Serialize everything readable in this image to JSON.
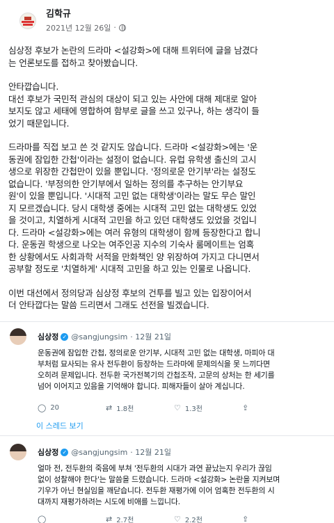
{
  "post": {
    "author": "김학규",
    "date": "2021년 12월 26일",
    "dot": "·",
    "paragraphs": [
      [
        "심상정 후보가 논란의 드라마 <설강화>에 대해 트위터에 글을 남겼다",
        "는 언론보도를 접하고 찾아봤습니다."
      ],
      [
        "안타깝습니다.",
        "대선 후보가 국민적 관심의 대상이 되고 있는 사안에 대해 제대로 알아",
        "보지도 않고 세태에 영합하여 함부로 글을 쓰고 있구나, 하는 생각이 들",
        "었기 때문입니다."
      ],
      [
        "드라마를 직접 보고 쓴 것 같지도 않습니다. 드라마 <설강화>에는 '운",
        "동권에 잠입한 간첩'이라는 설정이 없습니다. 유럽 유학생 출신의 고시",
        "생으로 위장한 간첩만이 있을 뿐입니다. '정의로운 안기부'라는 설정도",
        "없습니다. '부정의한 안기부에서 일하는 정의를 추구하는 안기부요",
        "원'이 있을 뿐입니다. '시대적 고민 없는 대학생'이라는 말도 무슨 말인",
        "지 모르겠습니다. 당시 대학생 중에는 시대적 고민 없는 대학생도 있었",
        "을 것이고, 치열하게 시대적 고민을 하고 있던 대학생도 있었을 것입니",
        "다. 드라마 <설강화>에는 여러 유형의 대학생이 함께 등장한다고 합니",
        "다. 운동권 학생으로 나오는 여주인공 지수의 기숙사 룸메이트는 엄혹",
        "한 상황에서도 사회과학 서적을 만화책인 양 위장하여 가지고 다니면서",
        "공부할 정도로 '치열하게' 시대적 고민을 하고 있는 인물로 나옵니다."
      ],
      [
        "이번 대선에서 정의당과 심상정 후보의 건투를 빌고 있는 입장이어서",
        "더 안타깝다는 말씀 드리면서 그래도 선전을 빌겠습니다."
      ]
    ]
  },
  "tweets": [
    {
      "name": "심상정",
      "handle": "@sangjungsim",
      "date": "· 12월 21일",
      "lines": [
        "운동권에 잠입한 간첩, 정의로운 안기부, 시대적 고민 없는 대학생, 마피아 대",
        "부처럼 묘사되는 유사 전두환이 등장하는 드라마에 문제의식을 못 느끼다면",
        "오히려 문제입니다. 전두환 국가전복기의 간첩조작, 고문의 상처는 한 세기를",
        "넘어 이어지고 있음을 기억해야 합니다. 피해자들이 살아 계십니다."
      ],
      "replies": "20",
      "retweets": "1.8천",
      "likes": "1.3천"
    },
    {
      "name": "심상정",
      "handle": "@sangjungsim",
      "date": "· 12월 21일",
      "lines": [
        "얼마 전, 전두환의 죽음에 부쳐 '전두환의 시대가 과연 끝났는지 우리가 끊임",
        "없이 성찰해야 한다'는 말씀을 드렸습니다. 드라마 <설강화> 논란을 지켜보며",
        "기우가 아닌 현실임을 깨닫습니다. 전두환 재평가에 이어 엄혹한 전두환의 시",
        "대까지 재평가하려는 시도에 비애를 느낍니다."
      ],
      "replies": "",
      "retweets": "2.7천",
      "likes": "2.2천"
    }
  ],
  "thread_link": "이 스레드 보기",
  "icons": {
    "reply": "reply-icon",
    "retweet": "retweet-icon",
    "like": "like-icon",
    "share": "share-icon",
    "globe": "globe-icon",
    "verified": "verified-badge-icon"
  },
  "colors": {
    "link": "#1d9bf0",
    "muted": "#536471",
    "divider": "#e4e6eb"
  }
}
